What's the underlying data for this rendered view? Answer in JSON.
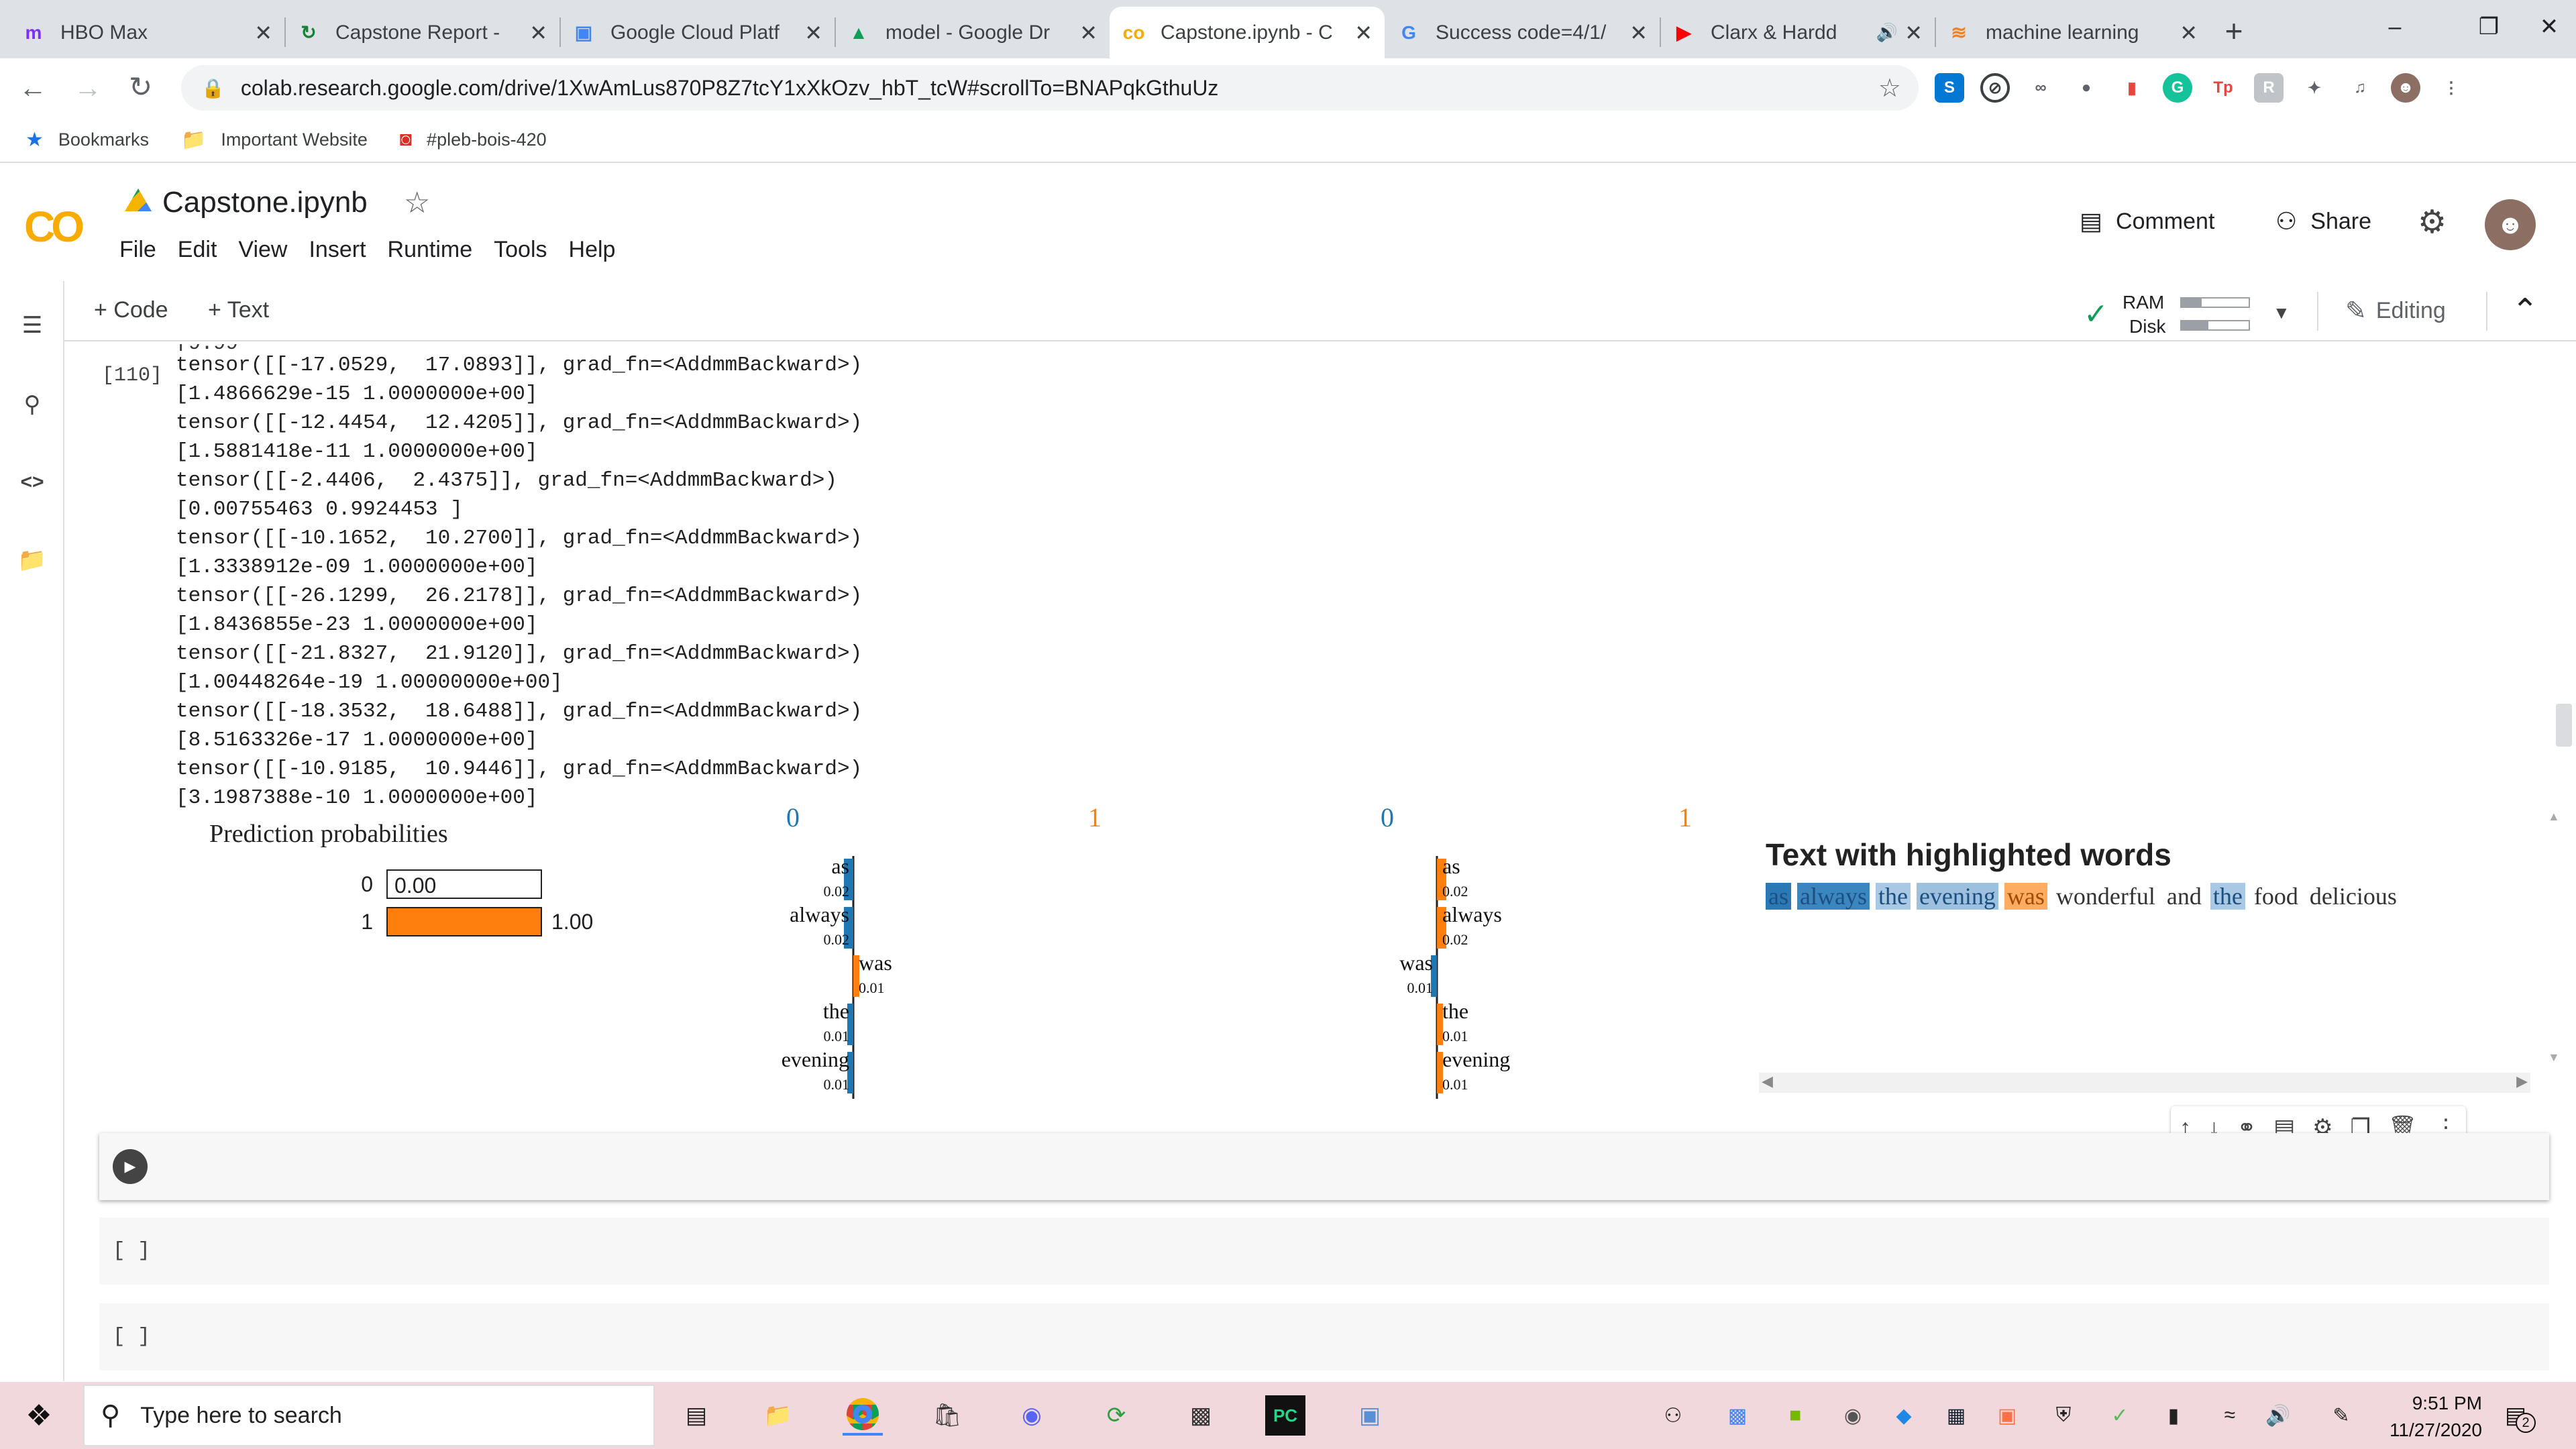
{
  "browser": {
    "tabs": [
      {
        "label": "HBO Max",
        "icon": "hbo-icon",
        "color": "#7b2ff7"
      },
      {
        "label": "Capstone Report -",
        "icon": "refresh-icon",
        "color": "#188038"
      },
      {
        "label": "Google Cloud Platf",
        "icon": "gcp-chip-icon",
        "color": "#4285f4"
      },
      {
        "label": "model - Google Dr",
        "icon": "drive-icon",
        "color": "#0f9d58"
      },
      {
        "label": "Capstone.ipynb - C",
        "icon": "colab-icon",
        "color": "#f9ab00"
      },
      {
        "label": "Success code=4/1/",
        "icon": "google-icon",
        "color": "#4285f4"
      },
      {
        "label": "Clarx & Hardd",
        "icon": "youtube-icon",
        "color": "#ff0000"
      },
      {
        "label": "machine learning",
        "icon": "stack-overflow-icon",
        "color": "#f48024"
      }
    ],
    "url": "colab.research.google.com/drive/1XwAmLus870P8Z7tcY1xXkOzv_hbT_tcW#scrollTo=BNAPqkGthuUz",
    "bookmarks": [
      {
        "label": "Bookmarks",
        "icon": "star-icon"
      },
      {
        "label": "Important Website",
        "icon": "folder-icon"
      },
      {
        "label": "#pleb-bois-420",
        "icon": "discord-icon"
      }
    ]
  },
  "colab": {
    "title": "Capstone.ipynb",
    "menu": [
      "File",
      "Edit",
      "View",
      "Insert",
      "Runtime",
      "Tools",
      "Help"
    ],
    "comment": "Comment",
    "share": "Share",
    "add_code": "+ Code",
    "add_text": "+ Text",
    "ram": "RAM",
    "disk": "Disk",
    "editing": "Editing"
  },
  "cell": {
    "exec_count": "[110]",
    "output_lines": [
      "tensor([[-17.0529,  17.0893]], grad_fn=<AddmmBackward>)",
      "[1.4866629e-15 1.0000000e+00]",
      "tensor([[-12.4454,  12.4205]], grad_fn=<AddmmBackward>)",
      "[1.5881418e-11 1.0000000e+00]",
      "tensor([[-2.4406,  2.4375]], grad_fn=<AddmmBackward>)",
      "[0.00755463 0.9924453 ]",
      "tensor([[-10.1652,  10.2700]], grad_fn=<AddmmBackward>)",
      "[1.3338912e-09 1.0000000e+00]",
      "tensor([[-26.1299,  26.2178]], grad_fn=<AddmmBackward>)",
      "[1.8436855e-23 1.0000000e+00]",
      "tensor([[-21.8327,  21.9120]], grad_fn=<AddmmBackward>)",
      "[1.00448264e-19 1.00000000e+00]",
      "tensor([[-18.3532,  18.6488]], grad_fn=<AddmmBackward>)",
      "[8.5163326e-17 1.0000000e+00]",
      "tensor([[-10.9185,  10.9446]], grad_fn=<AddmmBackward>)",
      "[3.1987388e-10 1.0000000e+00]"
    ],
    "lime": {
      "pred_title": "Prediction probabilities",
      "probs": [
        {
          "label": "0",
          "value": 0.0,
          "text": "0.00",
          "color": "#1f77b4"
        },
        {
          "label": "1",
          "value": 1.0,
          "text": "1.00",
          "color": "#ff7f0e"
        }
      ],
      "class_headers": [
        {
          "text": "0",
          "color": "#1f77b4"
        },
        {
          "text": "1",
          "color": "#ff7f0e"
        },
        {
          "text": "0",
          "color": "#1f77b4"
        },
        {
          "text": "1",
          "color": "#ff7f0e"
        }
      ],
      "left_words": [
        {
          "word": "as",
          "weight": "0.02",
          "side": "left",
          "color": "#1f77b4"
        },
        {
          "word": "always",
          "weight": "0.02",
          "side": "left",
          "color": "#1f77b4"
        },
        {
          "word": "was",
          "weight": "0.01",
          "side": "right",
          "color": "#ff7f0e"
        },
        {
          "word": "the",
          "weight": "0.01",
          "side": "left",
          "color": "#1f77b4"
        },
        {
          "word": "evening",
          "weight": "0.01",
          "side": "left",
          "color": "#1f77b4"
        }
      ],
      "right_words": [
        {
          "word": "as",
          "weight": "0.02",
          "side": "right",
          "color": "#ff7f0e"
        },
        {
          "word": "always",
          "weight": "0.02",
          "side": "right",
          "color": "#ff7f0e"
        },
        {
          "word": "was",
          "weight": "0.01",
          "side": "left",
          "color": "#1f77b4"
        },
        {
          "word": "the",
          "weight": "0.01",
          "side": "right",
          "color": "#ff7f0e"
        },
        {
          "word": "evening",
          "weight": "0.01",
          "side": "right",
          "color": "#ff7f0e"
        }
      ],
      "highlight_title": "Text with highlighted words",
      "sentence": [
        {
          "w": "as",
          "bg": "#2a79b5",
          "fg": "#1b4f80"
        },
        {
          "w": "always",
          "bg": "#3c86bf",
          "fg": "#1b4f80"
        },
        {
          "w": "the",
          "bg": "#a8c8e4",
          "fg": "#1b4f80"
        },
        {
          "w": "evening",
          "bg": "#9dc0df",
          "fg": "#1b4f80"
        },
        {
          "w": "was",
          "bg": "#ffab62",
          "fg": "#a14a00"
        },
        {
          "w": "wonderful",
          "bg": "",
          "fg": "#333333"
        },
        {
          "w": "and",
          "bg": "",
          "fg": "#333333"
        },
        {
          "w": "the",
          "bg": "#a8c8e4",
          "fg": "#1b4f80"
        },
        {
          "w": "food",
          "bg": "",
          "fg": "#333333"
        },
        {
          "w": "delicious",
          "bg": "",
          "fg": "#333333"
        }
      ]
    },
    "empty_cells": [
      "[ ]",
      "[ ]"
    ]
  },
  "taskbar": {
    "search_placeholder": "Type here to search",
    "time": "9:51 PM",
    "date": "11/27/2020",
    "notif_count": "2"
  }
}
